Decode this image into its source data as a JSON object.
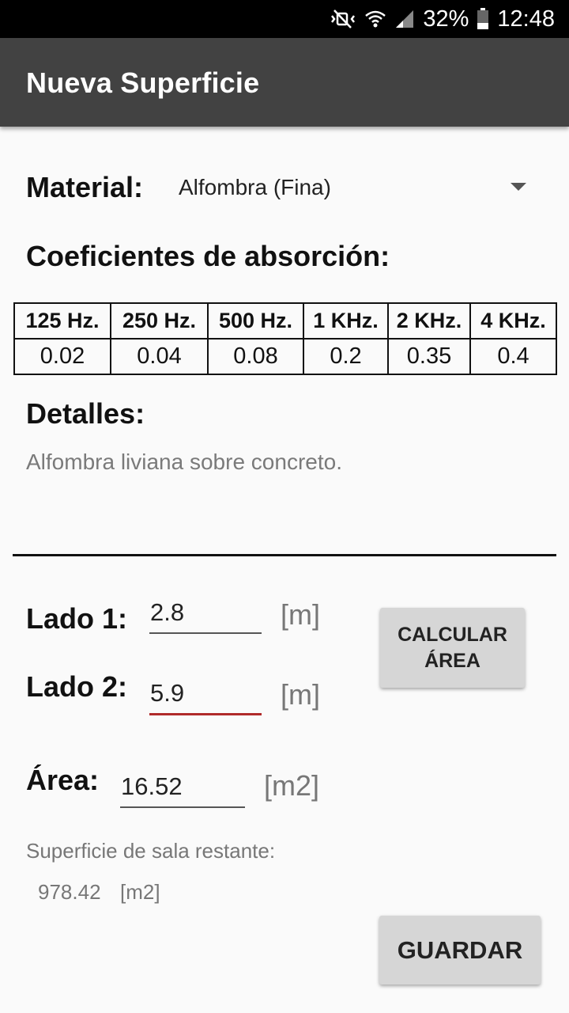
{
  "status_bar": {
    "battery": "32%",
    "time": "12:48",
    "icons": [
      "mute-icon",
      "wifi-icon",
      "signal-icon",
      "battery-icon"
    ]
  },
  "app_bar": {
    "title": "Nueva Superficie"
  },
  "material": {
    "label": "Material:",
    "selected": "Alfombra (Fina)"
  },
  "coeficientes": {
    "title": "Coeficientes de absorción:",
    "headers": [
      "125 Hz.",
      "250 Hz.",
      "500 Hz.",
      "1 KHz.",
      "2 KHz.",
      "4 KHz."
    ],
    "values": [
      "0.02",
      "0.04",
      "0.08",
      "0.2",
      "0.35",
      "0.4"
    ]
  },
  "detalles": {
    "title": "Detalles:",
    "text": "Alfombra liviana sobre concreto."
  },
  "lado1": {
    "label": "Lado 1:",
    "value": "2.8",
    "unit": "[m]"
  },
  "lado2": {
    "label": "Lado 2:",
    "value": "5.9",
    "unit": "[m]"
  },
  "area": {
    "label": "Área:",
    "value": "16.52",
    "unit": "[m2]"
  },
  "calcular_button": "CALCULAR ÁREA",
  "superficie": {
    "label": "Superficie de sala restante:",
    "value": "978.42",
    "unit": "[m2]"
  },
  "guardar_button": "GUARDAR",
  "colors": {
    "app_bar": "#424242",
    "focus_underline": "#b02a2a",
    "button_bg": "#d6d6d6"
  }
}
